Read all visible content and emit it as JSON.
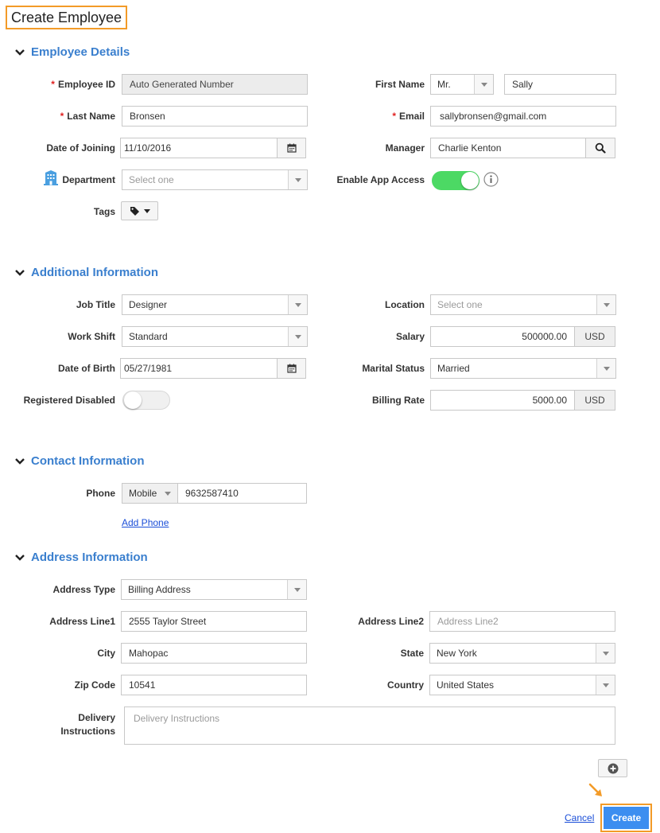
{
  "page": {
    "title": "Create Employee"
  },
  "sections": {
    "employee_details": "Employee Details",
    "additional_information": "Additional Information",
    "contact_information": "Contact Information",
    "address_information": "Address Information"
  },
  "employee": {
    "employee_id": {
      "label": "Employee ID",
      "value": "Auto Generated Number"
    },
    "first_name": {
      "label": "First Name",
      "salutation": "Mr.",
      "value": "Sally"
    },
    "last_name": {
      "label": "Last Name",
      "value": "Bronsen"
    },
    "email": {
      "label": "Email",
      "value": "sallybronsen@gmail.com"
    },
    "date_of_joining": {
      "label": "Date of Joining",
      "value": "11/10/2016"
    },
    "manager": {
      "label": "Manager",
      "value": "Charlie Kenton"
    },
    "department": {
      "label": "Department",
      "placeholder": "Select one"
    },
    "enable_app_access": {
      "label": "Enable App Access",
      "enabled": true
    },
    "tags": {
      "label": "Tags"
    }
  },
  "additional": {
    "job_title": {
      "label": "Job Title",
      "value": "Designer"
    },
    "location": {
      "label": "Location",
      "placeholder": "Select one"
    },
    "work_shift": {
      "label": "Work Shift",
      "value": "Standard"
    },
    "salary": {
      "label": "Salary",
      "value": "500000.00",
      "currency": "USD"
    },
    "date_of_birth": {
      "label": "Date of Birth",
      "value": "05/27/1981"
    },
    "marital_status": {
      "label": "Marital Status",
      "value": "Married"
    },
    "registered_disabled": {
      "label": "Registered Disabled",
      "enabled": false
    },
    "billing_rate": {
      "label": "Billing Rate",
      "value": "5000.00",
      "currency": "USD"
    }
  },
  "contact": {
    "phone": {
      "label": "Phone",
      "type": "Mobile",
      "value": "9632587410"
    },
    "add_phone": "Add Phone"
  },
  "address": {
    "address_type": {
      "label": "Address Type",
      "value": "Billing Address"
    },
    "address_line1": {
      "label": "Address Line1",
      "value": "2555 Taylor Street"
    },
    "address_line2": {
      "label": "Address Line2",
      "placeholder": "Address Line2"
    },
    "city": {
      "label": "City",
      "value": "Mahopac"
    },
    "state": {
      "label": "State",
      "value": "New York"
    },
    "zip_code": {
      "label": "Zip Code",
      "value": "10541"
    },
    "country": {
      "label": "Country",
      "value": "United States"
    },
    "delivery_instructions": {
      "label_line1": "Delivery",
      "label_line2": "Instructions",
      "placeholder": "Delivery Instructions"
    }
  },
  "actions": {
    "cancel": "Cancel",
    "create": "Create"
  },
  "colors": {
    "accent": "#3a7fce",
    "highlight": "#f39b28",
    "toggle_on": "#4cd964",
    "primary_button": "#3c8ef0",
    "required": "#e02020"
  },
  "icons": [
    "chevron-down-icon",
    "calendar-icon",
    "search-icon",
    "building-icon",
    "tag-icon",
    "info-icon",
    "plus-circle-icon",
    "arrow-pointer-icon"
  ]
}
